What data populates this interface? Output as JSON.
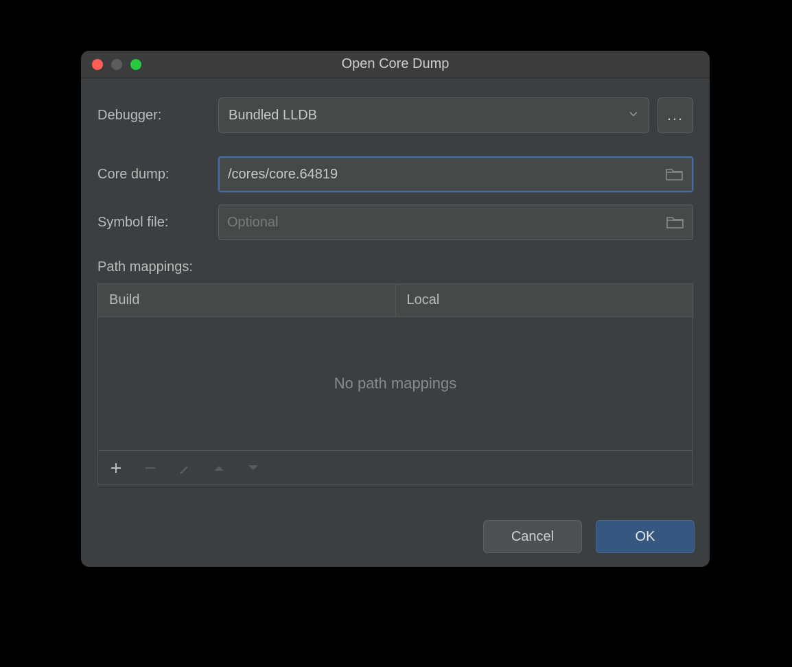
{
  "window": {
    "title": "Open Core Dump"
  },
  "form": {
    "debugger_label": "Debugger:",
    "debugger_value": "Bundled LLDB",
    "more_label": "...",
    "coredump_label": "Core dump:",
    "coredump_value": "/cores/core.64819",
    "symbol_label": "Symbol file:",
    "symbol_value": "",
    "symbol_placeholder": "Optional",
    "pathmappings_label": "Path mappings:",
    "table": {
      "col_build": "Build",
      "col_local": "Local",
      "empty_text": "No path mappings"
    }
  },
  "buttons": {
    "cancel": "Cancel",
    "ok": "OK"
  }
}
